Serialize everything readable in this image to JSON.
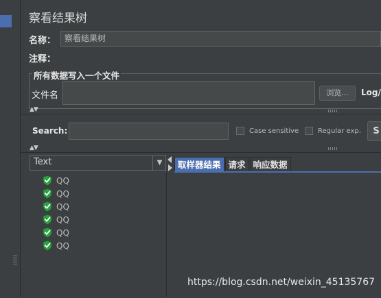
{
  "panel_title": "察看结果树",
  "name_label": "名称：",
  "name_value": "察看结果树",
  "comment_label": "注释：",
  "file_group_title": "所有数据写入一个文件",
  "filename_label": "文件名",
  "browse_label": "浏览...",
  "log_label": "Log/D",
  "search_label": "Search:",
  "case_sensitive_label": "Case sensitive",
  "regular_exp_label": "Regular exp.",
  "search_button_label": "S",
  "renderer_selected": "Text",
  "tree_items": [
    {
      "label": "QQ",
      "status": "success"
    },
    {
      "label": "QQ",
      "status": "success"
    },
    {
      "label": "QQ",
      "status": "success"
    },
    {
      "label": "QQ",
      "status": "success"
    },
    {
      "label": "QQ",
      "status": "success"
    },
    {
      "label": "QQ",
      "status": "success"
    }
  ],
  "tabs": [
    "取样器结果",
    "请求",
    "响应数据"
  ],
  "active_tab": 0,
  "watermark": "https://blog.csdn.net/weixin_45135767",
  "colors": {
    "accent": "#4b6eaf",
    "success_icon": "#2ea043",
    "background": "#3c3f41"
  }
}
